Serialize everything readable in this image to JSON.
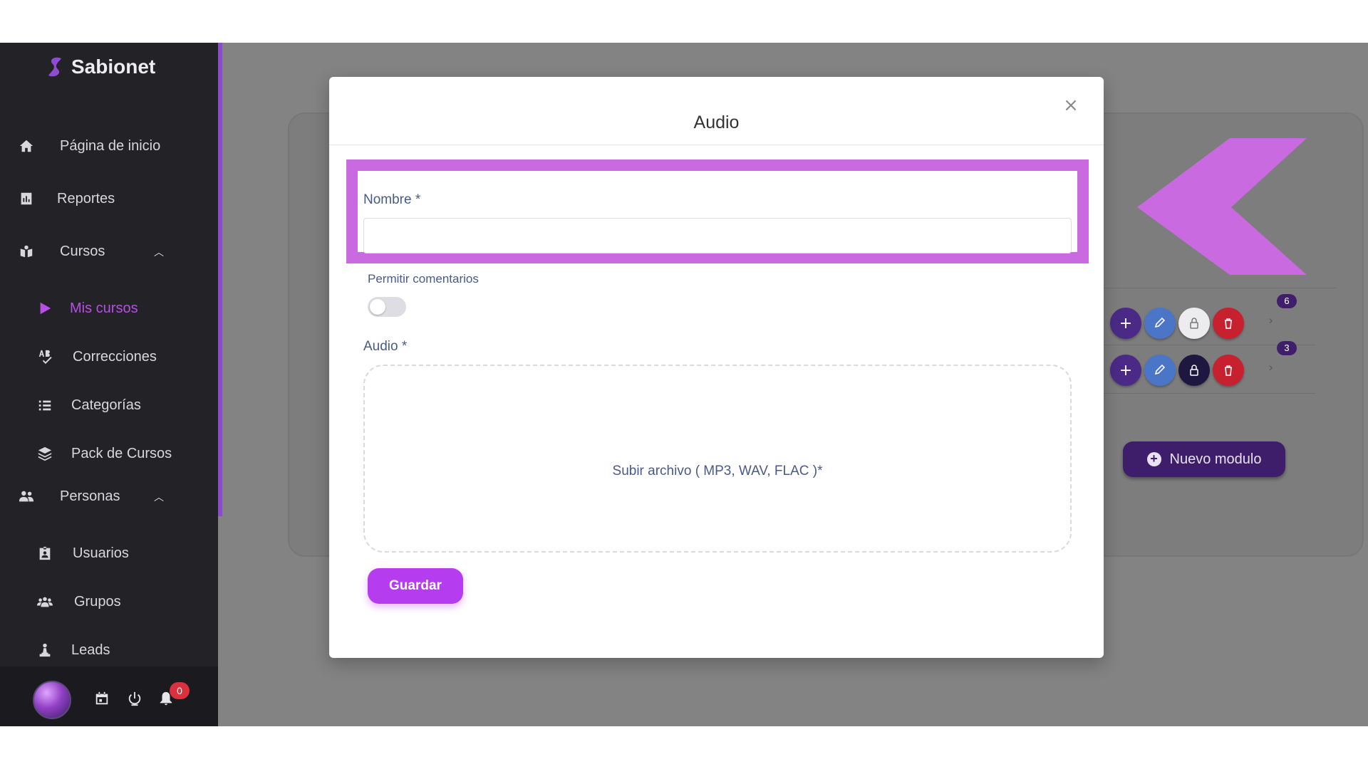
{
  "app": {
    "brand_name": "Sabionet",
    "accent_color": "#b84ee6",
    "highlight_color": "#c96ae1"
  },
  "sidebar": {
    "items": [
      {
        "label": "Página de inicio",
        "icon": "home-icon"
      },
      {
        "label": "Reportes",
        "icon": "report-icon"
      },
      {
        "label": "Cursos",
        "icon": "course-icon",
        "expanded": true
      },
      {
        "label": "Mis cursos",
        "icon": "play-icon",
        "active": true
      },
      {
        "label": "Correcciones",
        "icon": "spellcheck-icon"
      },
      {
        "label": "Categorías",
        "icon": "list-icon"
      },
      {
        "label": "Pack de Cursos",
        "icon": "layers-icon"
      },
      {
        "label": "Personas",
        "icon": "users-icon",
        "expanded": true
      },
      {
        "label": "Usuarios",
        "icon": "id-badge-icon"
      },
      {
        "label": "Grupos",
        "icon": "group-icon"
      },
      {
        "label": "Leads",
        "icon": "leads-icon"
      }
    ],
    "footer": {
      "notifications_count": "0"
    }
  },
  "background": {
    "rows": [
      {
        "count": "6",
        "lock_state": "unlocked"
      },
      {
        "count": "3",
        "lock_state": "locked"
      }
    ],
    "new_module_label": "Nuevo modulo"
  },
  "modal": {
    "title": "Audio",
    "close_symbol": "×",
    "name_label": "Nombre *",
    "name_value": "",
    "comments_label": "Permitir comentarios",
    "comments_enabled": false,
    "audio_label": "Audio *",
    "upload_text": "Subir archivo ( MP3, WAV, FLAC )*",
    "save_label": "Guardar"
  }
}
